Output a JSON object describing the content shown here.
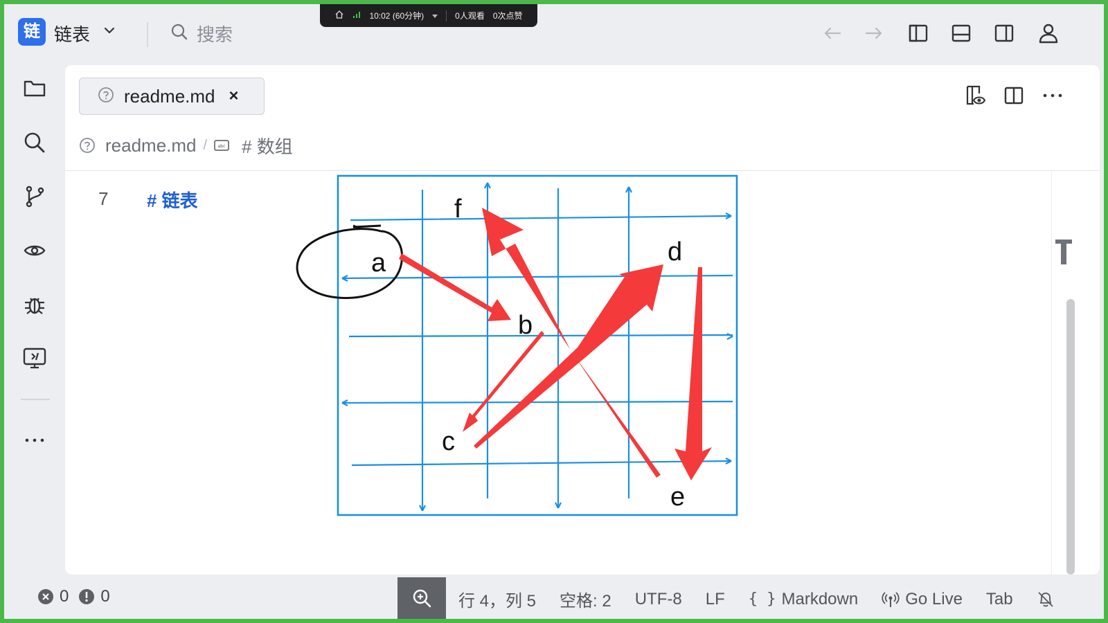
{
  "app": {
    "logo_char": "链",
    "title": "链表"
  },
  "search": {
    "label": "搜索"
  },
  "recording": {
    "time": "10:02 (60分钟)",
    "viewers": "0人观看",
    "likes": "0次点赞"
  },
  "icons": {
    "chevron": "chevron-down-icon",
    "search": "search-icon",
    "back": "arrow-left-icon",
    "forward": "arrow-right-icon",
    "layout_left": "sidebar-left-icon",
    "layout_bottom": "panel-bottom-icon",
    "layout_right": "sidebar-right-icon",
    "account": "account-icon"
  },
  "activity_bar": [
    {
      "name": "explorer-icon"
    },
    {
      "name": "search-icon"
    },
    {
      "name": "source-control-icon"
    },
    {
      "name": "preview-icon"
    },
    {
      "name": "debug-icon"
    },
    {
      "name": "remote-icon"
    },
    {
      "name": "more-icon"
    }
  ],
  "tab": {
    "label": "readme.md",
    "close": "×"
  },
  "breadcrumb": {
    "file": "readme.md",
    "sep": "/",
    "symbol": "# 数组"
  },
  "editor": {
    "line_number": "7",
    "line_text": "#  链表"
  },
  "drawing_labels": {
    "a": "a",
    "b": "b",
    "c": "c",
    "d": "d",
    "e": "e",
    "f": "f"
  },
  "status": {
    "errors": "0",
    "warnings": "0",
    "position": "行 4，列 5",
    "spaces": "空格: 2",
    "encoding": "UTF-8",
    "eol": "LF",
    "language": "Markdown",
    "golive": "Go Live",
    "tab": "Tab"
  },
  "colors": {
    "accent": "#2f6fec",
    "frame": "#4db84a",
    "grid": "#1a8fe6",
    "arrow": "#f43a3a",
    "heading": "#1f5fd6"
  }
}
